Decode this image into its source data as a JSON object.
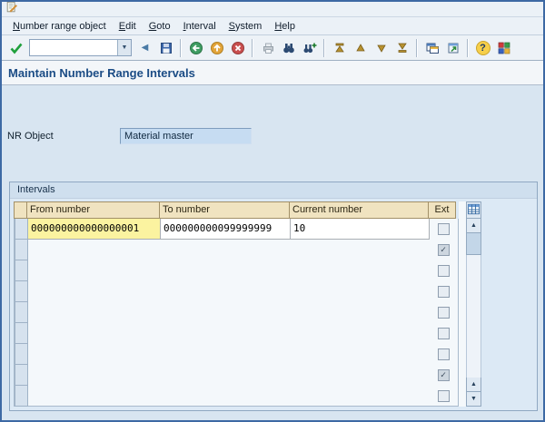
{
  "menu": {
    "items": [
      "Number range object",
      "Edit",
      "Goto",
      "Interval",
      "System",
      "Help"
    ]
  },
  "toolbar": {
    "command_value": ""
  },
  "header": {
    "title": "Maintain Number Range Intervals"
  },
  "form": {
    "nr_object_label": "NR Object",
    "nr_object_value": "Material master"
  },
  "intervals": {
    "title": "Intervals",
    "columns": {
      "from": "From number",
      "to": "To number",
      "current": "Current number",
      "ext": "Ext"
    },
    "rows": [
      {
        "from": "000000000000000001",
        "to": "000000000099999999",
        "current": "10",
        "ext": false,
        "selected": true
      },
      {
        "from": "",
        "to": "",
        "current": "",
        "ext": true
      },
      {
        "from": "",
        "to": "",
        "current": "",
        "ext": false
      },
      {
        "from": "",
        "to": "",
        "current": "",
        "ext": false
      },
      {
        "from": "",
        "to": "",
        "current": "",
        "ext": false
      },
      {
        "from": "",
        "to": "",
        "current": "",
        "ext": false
      },
      {
        "from": "",
        "to": "",
        "current": "",
        "ext": false
      },
      {
        "from": "",
        "to": "",
        "current": "",
        "ext": true
      },
      {
        "from": "",
        "to": "",
        "current": "",
        "ext": false
      }
    ]
  },
  "glyphs": {
    "up": "▲",
    "down": "▼",
    "left": "◀",
    "check": "✓",
    "question": "?",
    "dropdown": "▼"
  },
  "colors": {
    "title_text": "#1b4c85",
    "selected_cell": "#fbf3a0",
    "table_header": "#f0e3c0",
    "display_field": "#c6dcf2"
  }
}
